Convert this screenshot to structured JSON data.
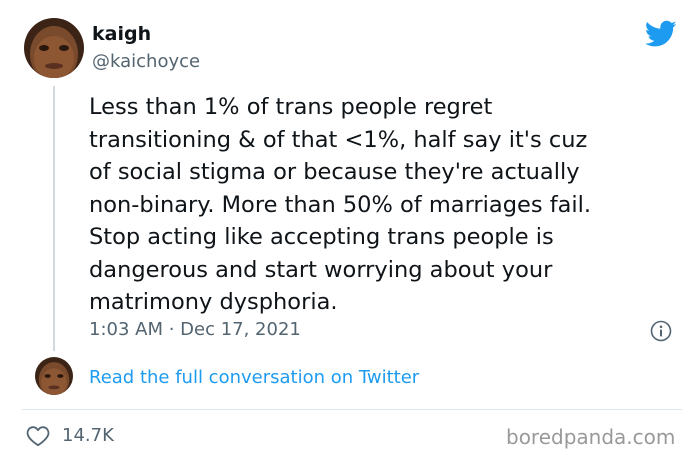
{
  "tweet": {
    "display_name": "kaigh",
    "handle": "@kaichoyce",
    "text_lines": [
      "Less than 1% of trans people regret",
      "transitioning & of that <1%, half say it's cuz",
      "of social stigma or because they're actually",
      "non-binary. More than 50% of marriages fail.",
      "Stop acting like accepting trans people is",
      "dangerous and start worrying about your",
      "matrimony dysphoria."
    ],
    "timestamp": "1:03 AM · Dec 17, 2021",
    "read_conversation": "Read the full conversation on Twitter",
    "like_count": "14.7K"
  },
  "watermark": "boredpanda.com",
  "colors": {
    "twitter_blue": "#1d9bf0",
    "muted_text": "#536471",
    "main_text": "#0f1419"
  },
  "icons": {
    "brand": "twitter-bird-icon",
    "info": "info-icon",
    "like": "heart-icon"
  }
}
